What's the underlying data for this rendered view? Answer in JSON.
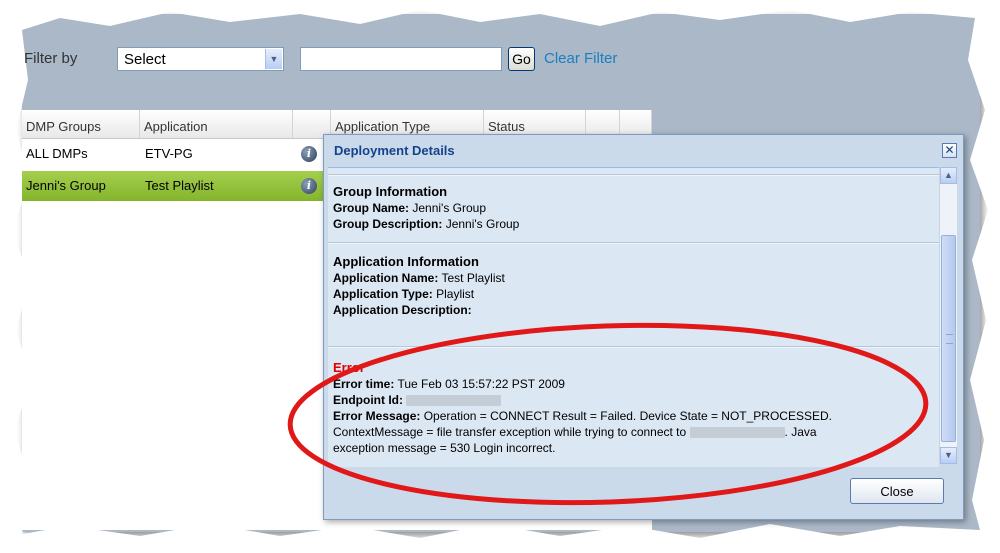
{
  "filter": {
    "label": "Filter by",
    "select_value": "Select",
    "text_value": "",
    "go_label": "Go",
    "clear_label": "Clear Filter"
  },
  "grid": {
    "columns": [
      "DMP Groups",
      "Application",
      "",
      "Application Type",
      "Status",
      "",
      ""
    ],
    "rows": [
      {
        "group": "ALL DMPs",
        "application": "ETV-PG",
        "selected": false
      },
      {
        "group": "Jenni's Group",
        "application": "Test Playlist",
        "selected": true
      }
    ]
  },
  "dialog": {
    "title": "Deployment Details",
    "group": {
      "heading": "Group Information",
      "name_label": "Group Name:",
      "name_value": "Jenni's Group",
      "desc_label": "Group Description:",
      "desc_value": "Jenni's Group"
    },
    "application": {
      "heading": "Application Information",
      "name_label": "Application Name:",
      "name_value": "Test Playlist",
      "type_label": "Application Type:",
      "type_value": "Playlist",
      "desc_label": "Application Description:"
    },
    "error": {
      "heading": "Error",
      "time_label": "Error time:",
      "time_value": "Tue Feb 03 15:57:22 PST 2009",
      "endpoint_label": "Endpoint Id:",
      "message_label": "Error Message:",
      "message_line1": "Operation = CONNECT Result = Failed. Device State = NOT_PROCESSED.",
      "message_line2a": "ContextMessage = file transfer exception while trying to connect to",
      "message_line2b": ". Java",
      "message_line3": "exception message = 530 Login incorrect."
    },
    "close_label": "Close"
  },
  "colors": {
    "panel": "#aab8c8",
    "selected_row": "#94c43c",
    "error_text": "#e00000",
    "highlight_ellipse": "#e01818",
    "dialog_title": "#15428b",
    "link": "#1a7fbf"
  },
  "icons": {
    "info": "info-icon",
    "dropdown": "chevron-down-icon",
    "close": "close-icon",
    "scroll_up": "arrow-up-icon",
    "scroll_down": "arrow-down-icon"
  }
}
